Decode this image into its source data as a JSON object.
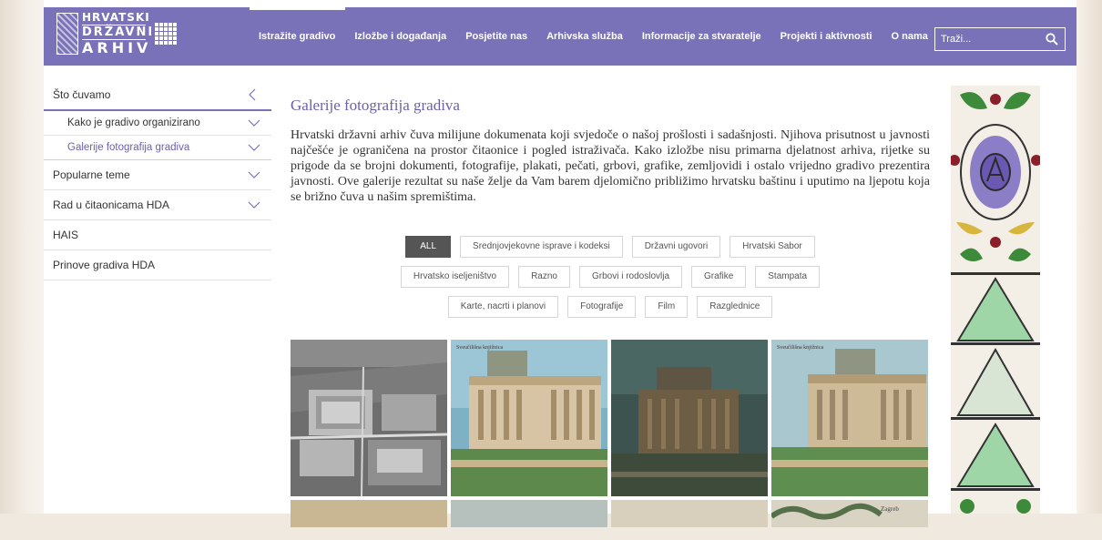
{
  "header": {
    "logo": {
      "line1": "HRVATSKI",
      "line2": "DRŽAVNI",
      "line3": "ARHIV"
    },
    "nav": [
      {
        "label": "Istražite gradivo",
        "active": true
      },
      {
        "label": "Izložbe i događanja",
        "active": false
      },
      {
        "label": "Posjetite nas",
        "active": false
      },
      {
        "label": "Arhivska služba",
        "active": false
      },
      {
        "label": "Informacije za stvaratelje",
        "active": false
      },
      {
        "label": "Projekti i aktivnosti",
        "active": false
      },
      {
        "label": "O nama",
        "active": false
      }
    ],
    "search": {
      "placeholder": "Traži...",
      "icon": "search-icon"
    }
  },
  "sidebar": {
    "items": [
      {
        "label": "Što čuvamo",
        "icon": "chevron-left-icon"
      },
      {
        "label": "Kako je gradivo organizirano",
        "icon": "chevron-down-icon"
      },
      {
        "label": "Galerije fotografija gradiva",
        "icon": "chevron-down-icon"
      },
      {
        "label": "Popularne teme",
        "icon": "chevron-down-icon"
      },
      {
        "label": "Rad u čitaonicama HDA",
        "icon": "chevron-down-icon"
      },
      {
        "label": "HAIS"
      },
      {
        "label": "Prinove gradiva HDA"
      }
    ]
  },
  "main": {
    "title": "Galerije fotografija gradiva",
    "intro": "Hrvatski državni arhiv čuva milijune dokumenata koji svjedoče o našoj prošlosti i sadašnjosti. Njihova prisutnost u javnosti najčešće je ograničena na prostor čitaonice i pogled istraživača. Kako izložbe nisu primarna djelatnost arhiva, rijetke su prigode da se brojni dokumenti, fotografije, plakati, pečati, grbovi, grafike, zemljovidi i ostalo vrijedno gradivo prezentira javnosti. Ove galerije rezultat su naše želje da Vam barem djelomično približimo hrvatsku baštinu i uputimo na ljepotu koja se brižno čuva u našim spremištima.",
    "filters": {
      "row1": [
        "ALL",
        "Srednjovjekovne isprave i kodeksi",
        "Državni ugovori",
        "Hrvatski Sabor"
      ],
      "row2": [
        "Hrvatsko iseljeništvo",
        "Razno",
        "Grbovi i rodoslovlja",
        "Grafike",
        "Stampata"
      ],
      "row3": [
        "Karte, nacrti i planovi",
        "Fotografije",
        "Film",
        "Razglednice"
      ],
      "active": "ALL"
    },
    "gallery": {
      "captions": [
        "Sveučilišna knjižnica",
        "Sveučilišna knjižnica",
        "Zagreb"
      ]
    }
  },
  "colors": {
    "header": "#7a72b8",
    "accent": "#6b60ae",
    "active_filter": "#555555"
  }
}
